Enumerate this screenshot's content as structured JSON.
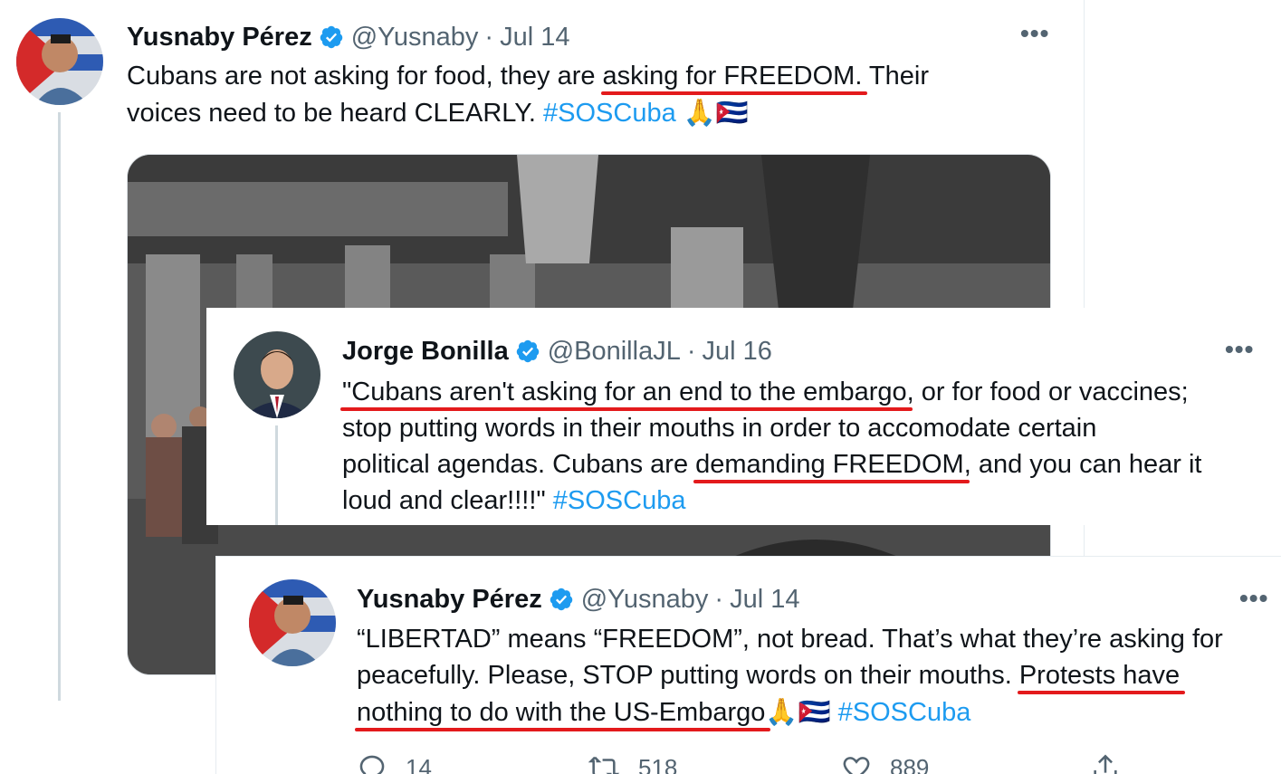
{
  "tweet1": {
    "name": "Yusnaby Pérez",
    "handle": "@Yusnaby",
    "separator": "·",
    "date": "Jul 14",
    "more": "•••",
    "text_a": "Cubans are not asking for food, they are ",
    "text_b": "asking for FREEDOM.",
    "text_c": " Their",
    "text_d": "voices need to be heard CLEARLY. ",
    "hashtag": "#SOSCuba",
    "emoji": "🙏🇨🇺"
  },
  "tweet2": {
    "name": "Jorge Bonilla",
    "handle": "@BonillaJL",
    "separator": "·",
    "date": "Jul 16",
    "more": "•••",
    "line1_a": "\"Cubans aren't asking for an end to the embargo",
    "line1_b": ", or for food or vaccines;",
    "line2": "stop putting words in their mouths in order to accomodate certain",
    "line3_a": "political agendas. Cubans are ",
    "line3_b": "demanding FREEDOM",
    "line3_c": ", and you can hear it",
    "line4_a": "loud and clear!!!!\" ",
    "hashtag": "#SOSCuba"
  },
  "tweet3": {
    "name": "Yusnaby Pérez",
    "handle": "@Yusnaby",
    "separator": "·",
    "date": "Jul 14",
    "more": "•••",
    "line1": "“LIBERTAD” means “FREEDOM”, not bread. That’s what they’re asking for",
    "line2_a": "peacefully.  Please, STOP putting words on their mouths. ",
    "line2_b": "Protests have",
    "line3_a": "nothing to do with the US-Embargo",
    "emoji": "🙏🇨🇺",
    "hashtag": "#SOSCuba",
    "replies": "14",
    "retweets": "518",
    "likes": "889"
  },
  "colors": {
    "accent": "#1d9bf0",
    "underline": "#e31a1c",
    "muted": "#536471"
  },
  "icons": [
    "verified-badge-icon",
    "more-icon",
    "reply-icon",
    "retweet-icon",
    "like-icon",
    "share-icon"
  ]
}
